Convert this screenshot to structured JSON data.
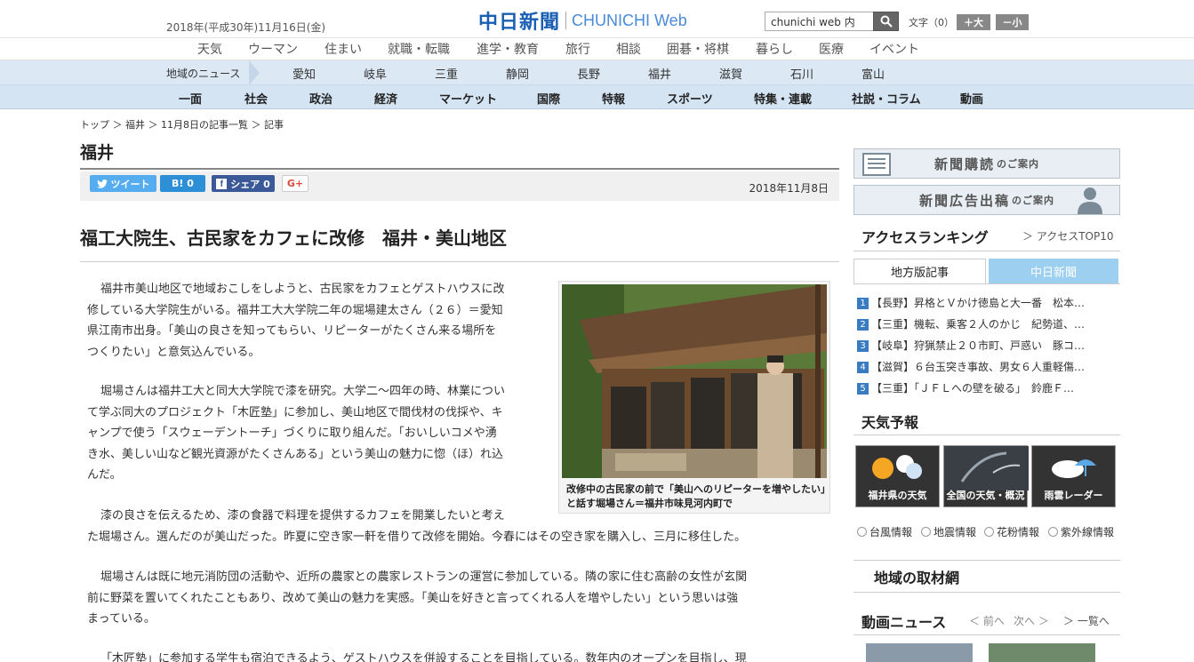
{
  "header": {
    "date": "2018年(平成30年)11月16日(金)",
    "logo_jp": "中日新聞",
    "logo_en": "CHUNICHI Web",
    "search_placeholder": "chunichi web 内",
    "fontsize_label": "文字（0）",
    "fontsize_plus": "＋大",
    "fontsize_minus": "－小"
  },
  "category_nav": [
    "天気",
    "ウーマン",
    "住まい",
    "就職・転職",
    "進学・教育",
    "旅行",
    "相談",
    "囲碁・将棋",
    "暮らし",
    "医療",
    "イベント"
  ],
  "region_nav": {
    "label": "地域のニュース",
    "items": [
      "愛知",
      "岐阜",
      "三重",
      "静岡",
      "長野",
      "福井",
      "滋賀",
      "石川",
      "富山"
    ]
  },
  "main_nav": [
    "一面",
    "社会",
    "政治",
    "経済",
    "マーケット",
    "国際",
    "特報",
    "スポーツ",
    "特集・連載",
    "社説・コラム",
    "動画"
  ],
  "breadcrumb": "トップ ＞ 福井 ＞ 11月8日の記事一覧 ＞ 記事",
  "section_title": "福井",
  "share": {
    "tweet": "ツイート",
    "hatena": "B! 0",
    "facebook": "シェア 0",
    "gplus": "G+"
  },
  "article": {
    "date": "2018年11月8日",
    "headline": "福工大院生、古民家をカフェに改修　福井・美山地区",
    "caption": "改修中の古民家の前で「美山へのリピーターを増やしたい」と話す堀場さん＝福井市味見河内町で",
    "p1": [
      "福井市美山地区で地域おこしをしようと、古民家をカフェとゲストハウスに改",
      "修している大学院生がいる。福井工大大学院二年の堀場建太さん（２６）＝愛知",
      "県江南市出身。「美山の良さを知ってもらい、リピーターがたくさん来る場所を",
      "つくりたい」と意気込んでいる。"
    ],
    "p2": [
      "堀場さんは福井工大と同大大学院で漆を研究。大学二〜四年の時、林業につい",
      "て学ぶ同大のプロジェクト「木匠塾」に参加し、美山地区で間伐材の伐採や、キ",
      "ャンプで使う「スウェーデントーチ」づくりに取り組んだ。「おいしいコメや湧",
      "き水、美しい山など観光資源がたくさんある」という美山の魅力に惚（ほ）れ込",
      "んだ。"
    ],
    "p3": [
      "漆の良さを伝えるため、漆の食器で料理を提供するカフェを開業したいと考え",
      "た堀場さん。選んだのが美山だった。昨夏に空き家一軒を借りて改修を開始。今春にはその空き家を購入し、三月に移住した。"
    ],
    "p4": [
      "堀場さんは既に地元消防団の活動や、近所の農家との農家レストランの運営に参加している。隣の家に住む高齢の女性が玄関",
      "前に野菜を置いてくれたこともあり、改めて美山の魅力を実感。「美山を好きと言ってくれる人を増やしたい」という思いは強",
      "まっている。"
    ],
    "p5": "「木匠塾」に参加する学生も宿泊できるよう、ゲストハウスを併設することを目指している。数年内のオープンを目指し、現"
  },
  "sidebar": {
    "banner1_main": "新聞購読",
    "banner1_sub": "のご案内",
    "banner2_main": "新聞広告出稿",
    "banner2_sub": "のご案内",
    "ranking_title": "アクセスランキング",
    "ranking_sub": "＞ アクセスTOP10",
    "tab_local": "地方版記事",
    "tab_chunichi": "中日新聞",
    "ranking": [
      {
        "num": "1",
        "text": "【長野】昇格とＶかけ徳島と大一番　松本…"
      },
      {
        "num": "2",
        "text": "【三重】機転、乗客２人のかじ　紀勢道、…"
      },
      {
        "num": "3",
        "text": "【岐阜】狩猟禁止２０市町、戸惑い　豚コ…"
      },
      {
        "num": "4",
        "text": "【滋賀】６台玉突き事故、男女６人重軽傷…"
      },
      {
        "num": "5",
        "text": "【三重】「ＪＦＬへの壁を破る」　鈴鹿Ｆ…"
      }
    ],
    "weather_title": "天気予報",
    "weather_tiles": [
      "福井県の天気",
      "全国の天気・概況",
      "雨雲レーダー"
    ],
    "weather_links": [
      "台風情報",
      "地震情報",
      "花粉情報",
      "紫外線情報"
    ],
    "local_title": "地域の取材網",
    "video_title": "動画ニュース",
    "video_prev": "＜ 前へ",
    "video_next": "次へ ＞",
    "video_list": "＞ 一覧へ"
  },
  "colors": {
    "logo_blue": "#1a5fb4",
    "region_bar": "#dce8f4",
    "main_nav_bar": "#d4e4f3",
    "tab_active": "#9dd0f0",
    "rank_num": "#3a7cc1"
  }
}
